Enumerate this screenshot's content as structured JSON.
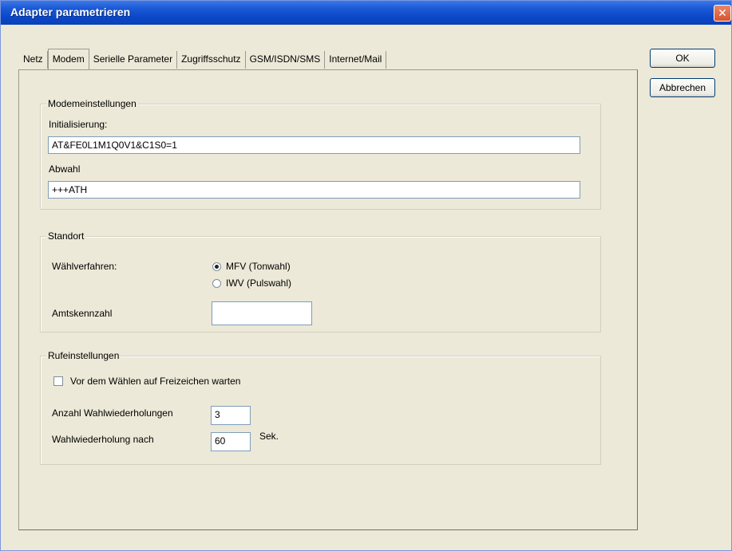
{
  "window": {
    "title": "Adapter parametrieren",
    "close_glyph": "✕"
  },
  "tabs": [
    {
      "label": "Netz",
      "active": false
    },
    {
      "label": "Modem",
      "active": true
    },
    {
      "label": "Serielle Parameter",
      "active": false
    },
    {
      "label": "Zugriffsschutz",
      "active": false
    },
    {
      "label": "GSM/ISDN/SMS",
      "active": false
    },
    {
      "label": "Internet/Mail",
      "active": false
    }
  ],
  "buttons": {
    "ok": "OK",
    "cancel": "Abbrechen"
  },
  "modem": {
    "legend": "Modemeinstellungen",
    "init_label": "Initialisierung:",
    "init_value": "AT&FE0L1M1Q0V1&C1S0=1",
    "hangup_label": "Abwahl",
    "hangup_value": "+++ATH"
  },
  "standort": {
    "legend": "Standort",
    "dial_method_label": "Wählverfahren:",
    "radio_tone": "MFV (Tonwahl)",
    "radio_pulse": "IWV (Pulswahl)",
    "selected": "tone",
    "prefix_label": "Amtskennzahl",
    "prefix_value": ""
  },
  "calls": {
    "legend": "Rufeinstellungen",
    "wait_tone_label": "Vor dem Wählen auf Freizeichen warten",
    "wait_tone_checked": false,
    "retries_label": "Anzahl Wahlwiederholungen",
    "retries_value": "3",
    "retry_after_label": "Wahlwiederholung nach",
    "retry_after_value": "60",
    "retry_after_unit": "Sek."
  }
}
